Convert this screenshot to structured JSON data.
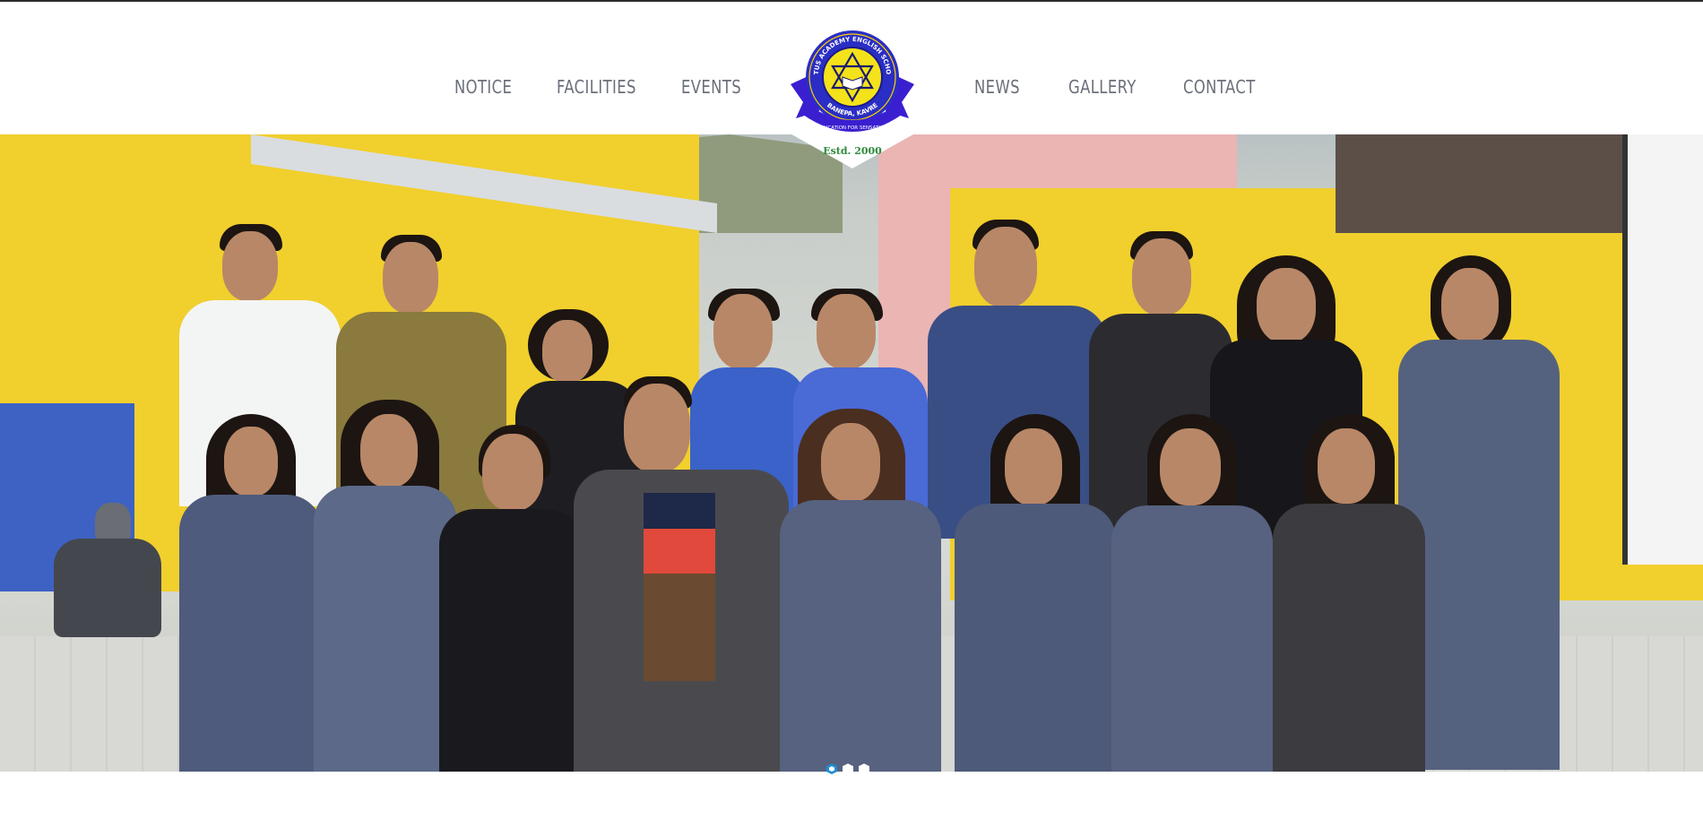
{
  "nav": {
    "left": [
      {
        "label": "NOTICE"
      },
      {
        "label": "FACILITIES"
      },
      {
        "label": "EVENTS"
      }
    ],
    "right": [
      {
        "label": "NEWS"
      },
      {
        "label": "GALLERY"
      },
      {
        "label": "CONTACT"
      }
    ]
  },
  "logo": {
    "ring_text_top": "LOTUS ACADEMY ENGLISH SCHOOL",
    "ring_text_bottom": "BANEPA, KAVRE",
    "ribbon_text": "EDUCATION FOR SENSATION",
    "estd": "Estd. 2000",
    "colors": {
      "ring": "#2a2ec4",
      "ribbon": "#3a1fd0",
      "center": "#f4e21a"
    }
  },
  "hero": {
    "description_icon": "group-photo-image"
  },
  "slider": {
    "total": 3,
    "active_index": 0,
    "accent": "#1f8ed6"
  }
}
